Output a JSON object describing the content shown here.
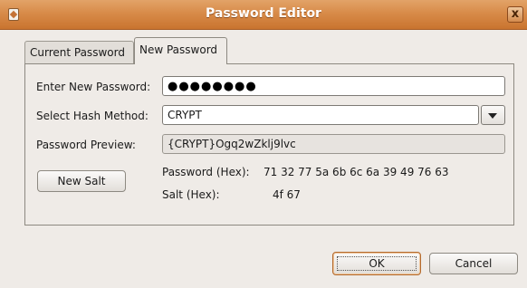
{
  "window": {
    "title": "Password Editor",
    "close_glyph": "x"
  },
  "tabs": [
    {
      "label": "Current Password"
    },
    {
      "label": "New Password"
    }
  ],
  "form": {
    "enter_label": "Enter New Password:",
    "password_dots": "●●●●●●●●",
    "hash_label": "Select Hash Method:",
    "hash_value": "CRYPT",
    "preview_label": "Password Preview:",
    "preview_value": "{CRYPT}Ogq2wZklj9lvc",
    "new_salt_label": "New Salt",
    "password_hex_label": "Password (Hex):",
    "password_hex_value": "71 32 77 5a 6b 6c 6a 39 49 76 63",
    "salt_hex_label": "Salt (Hex):",
    "salt_hex_value": "4f 67"
  },
  "buttons": {
    "ok": "OK",
    "cancel": "Cancel"
  },
  "colors": {
    "titlebar": "#d88b49",
    "dialog_bg": "#efebe7",
    "default_button_border": "#b36a2e"
  },
  "icons": {
    "app": "window-app-icon",
    "close": "close-icon",
    "combo": "chevron-down-icon"
  }
}
